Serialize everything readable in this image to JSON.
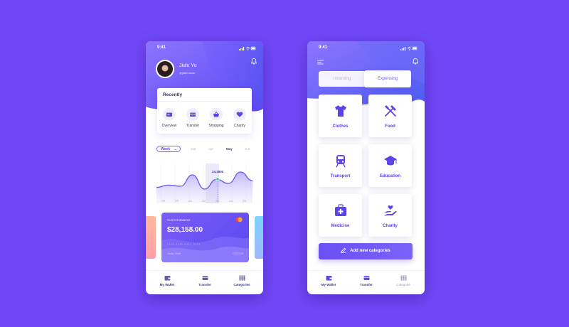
{
  "phone1": {
    "status": {
      "time": "9:41"
    },
    "user": {
      "name": "Jiulu Yu",
      "handle": "@jattimdude"
    },
    "recently": {
      "title": "Recently",
      "items": [
        {
          "label": "Overview",
          "icon": "overview-icon"
        },
        {
          "label": "Transfer",
          "icon": "transfer-icon"
        },
        {
          "label": "Shopping",
          "icon": "shopping-basket-icon"
        },
        {
          "label": "Charity",
          "icon": "heart-icon"
        }
      ]
    },
    "period": {
      "selected": "Week",
      "months": [
        "Mar",
        "Apr",
        "May",
        "Jun"
      ],
      "active_month": "May"
    },
    "chart_data": {
      "type": "area",
      "x": [
        "19",
        "20",
        "21",
        "22",
        "23",
        "24",
        "25"
      ],
      "values": [
        48,
        52,
        50,
        70,
        45,
        62,
        55,
        75,
        60
      ],
      "annotation": "24,380€",
      "highlight": "23"
    },
    "balance_card": {
      "label": "Current Balance",
      "amount": "$28,158.00",
      "number": "**** **** **** ****",
      "holder": "Jiuliu Gfott",
      "expiry": "03/2070"
    },
    "nav": [
      {
        "label": "My Wallet",
        "active": true
      },
      {
        "label": "Transfer",
        "active": true
      },
      {
        "label": "Categories",
        "active": true
      }
    ]
  },
  "phone2": {
    "status": {
      "time": "9:41"
    },
    "tabs": {
      "incoming": "Incoming",
      "expensing": "Expensing"
    },
    "categories": [
      {
        "label": "Clothes",
        "icon": "shirt-icon"
      },
      {
        "label": "Food",
        "icon": "fork-knife-icon"
      },
      {
        "label": "Transport",
        "icon": "train-icon"
      },
      {
        "label": "Education",
        "icon": "graduation-cap-icon"
      },
      {
        "label": "Medicine",
        "icon": "medical-kit-icon"
      },
      {
        "label": "Charity",
        "icon": "hand-heart-icon"
      }
    ],
    "add_button": "Add new categories",
    "nav": [
      {
        "label": "My Wallet",
        "active": true
      },
      {
        "label": "Transfer",
        "active": true
      },
      {
        "label": "Categorie",
        "active": false
      }
    ]
  },
  "colors": {
    "background": "#7047f6",
    "accent": "#5b45e6",
    "header_gradient_start": "#8a6cff",
    "header_gradient_end": "#4d5cf3"
  }
}
